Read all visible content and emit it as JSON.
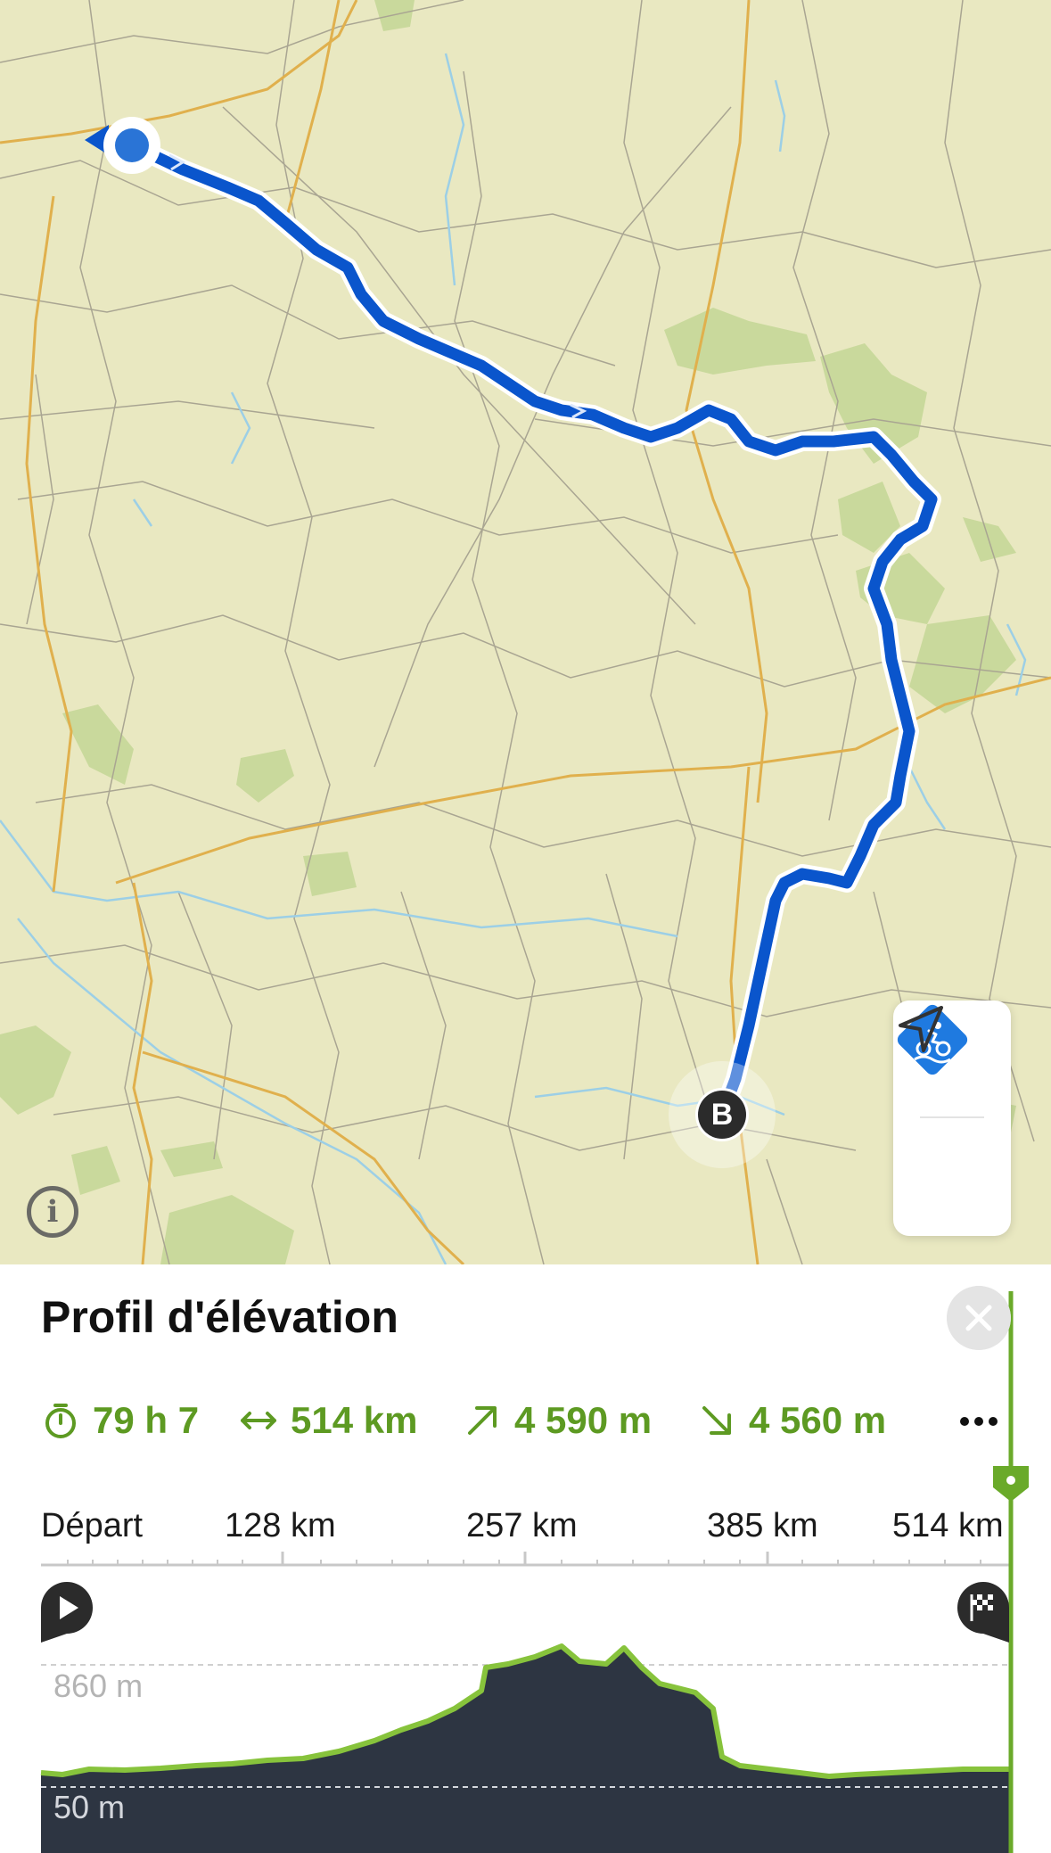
{
  "map": {
    "end_marker_label": "B",
    "route_color": "#0a55cc",
    "water_color": "#9ccfe6",
    "road_color": "#e2b04e",
    "forest_color": "#c7d89a"
  },
  "controls": {
    "profile_icon": "cycling-profile-icon",
    "locate_icon": "navigation-arrow-icon",
    "info_icon": "info-icon",
    "info_glyph": "i"
  },
  "elevation_profile": {
    "title": "Profil d'élévation",
    "stats": {
      "duration": "79 h 7",
      "distance": "514 km",
      "ascent": "4 590 m",
      "descent": "4 560 m"
    },
    "distance_ticks": [
      "Départ",
      "128 km",
      "257 km",
      "385 km",
      "514 km"
    ],
    "elevation_max_label": "860 m",
    "elevation_min_label": "50 m",
    "accent_color": "#5d9a22",
    "fill_color": "#2d3542",
    "line_color": "#87c33c"
  }
}
